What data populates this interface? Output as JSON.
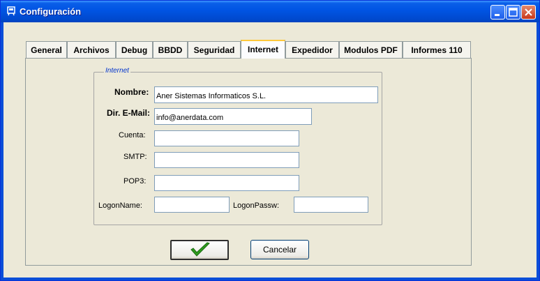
{
  "window": {
    "title": "Configuración"
  },
  "tabs": [
    {
      "label": "General"
    },
    {
      "label": "Archivos"
    },
    {
      "label": "Debug"
    },
    {
      "label": "BBDD"
    },
    {
      "label": "Seguridad"
    },
    {
      "label": "Internet",
      "active": true
    },
    {
      "label": "Expedidor"
    },
    {
      "label": "Modulos PDF"
    },
    {
      "label": "Informes 110"
    }
  ],
  "group": {
    "legend": "Internet"
  },
  "form": {
    "nombre": {
      "label": "Nombre:",
      "value": "Aner Sistemas Informaticos S.L."
    },
    "email": {
      "label": "Dir. E-Mail:",
      "value": "info@anerdata.com"
    },
    "cuenta": {
      "label": "Cuenta:",
      "value": ""
    },
    "smtp": {
      "label": "SMTP:",
      "value": ""
    },
    "pop3": {
      "label": "POP3:",
      "value": ""
    },
    "logonname": {
      "label": "LogonName:",
      "value": ""
    },
    "logonpassw": {
      "label": "LogonPassw:",
      "value": ""
    }
  },
  "buttons": {
    "ok_icon": "checkmark-icon",
    "cancel": "Cancelar"
  },
  "colors": {
    "titlebar": "#0054E3",
    "active_tab_highlight": "#FFC83C",
    "legend": "#0033CC",
    "check": "#2E9C1E"
  }
}
